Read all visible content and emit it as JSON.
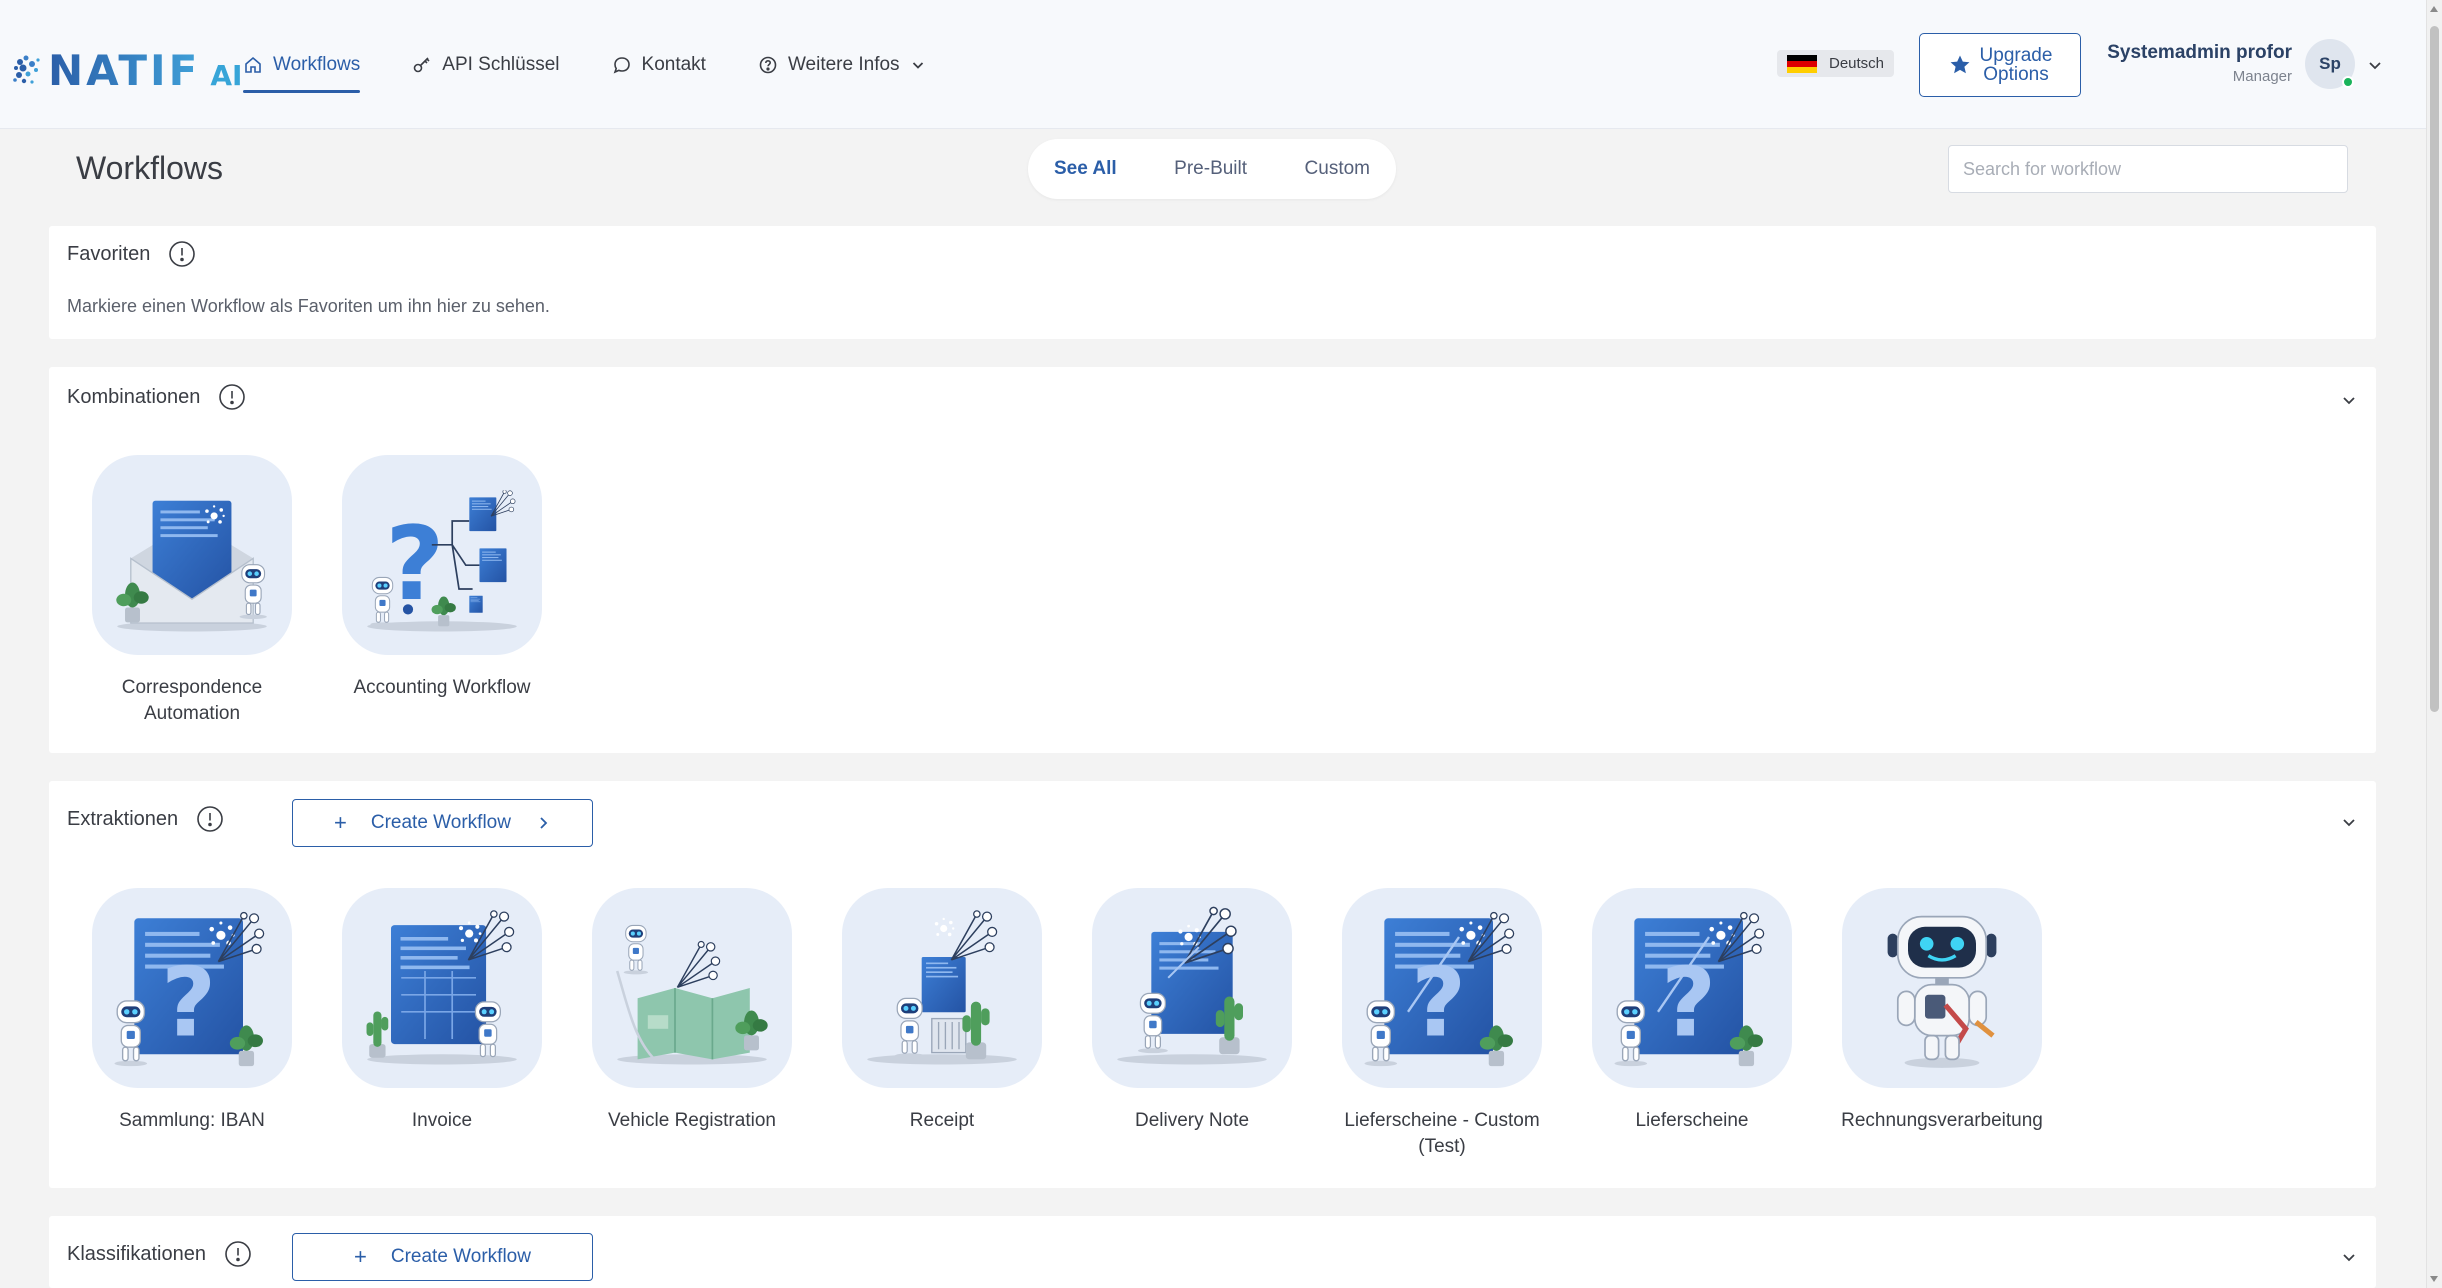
{
  "header": {
    "logo_text": "NATIF",
    "logo_ai": "AI",
    "nav": [
      {
        "label": "Workflows",
        "icon": "home-icon",
        "active": true
      },
      {
        "label": "API Schlüssel",
        "icon": "key-icon"
      },
      {
        "label": "Kontakt",
        "icon": "chat-icon"
      },
      {
        "label": "Weitere Infos",
        "icon": "help-circle-icon"
      }
    ],
    "language": "Deutsch",
    "upgrade_line1": "Upgrade",
    "upgrade_line2": "Options",
    "user_name": "Systemadmin profor",
    "user_role": "Manager",
    "avatar_initials": "Sp"
  },
  "page": {
    "title": "Workflows",
    "filters": [
      "See All",
      "Pre-Built",
      "Custom"
    ],
    "active_filter": "See All",
    "search_placeholder": "Search for workflow"
  },
  "sections": {
    "favoriten": {
      "title": "Favoriten",
      "description": "Markiere einen Workflow als Favoriten um ihn hier zu sehen."
    },
    "kombinationen": {
      "title": "Kombinationen",
      "items": [
        "Correspondence Automation",
        "Accounting Workflow"
      ]
    },
    "extraktionen": {
      "title": "Extraktionen",
      "create_label": "Create Workflow",
      "items": [
        "Sammlung: IBAN",
        "Invoice",
        "Vehicle Registration",
        "Receipt",
        "Delivery Note",
        "Lieferscheine - Custom (Test)",
        "Lieferscheine",
        "Rechnungsverarbeitung"
      ]
    },
    "klassifikationen": {
      "title": "Klassifikationen",
      "create_label": "Create Workflow"
    }
  },
  "colors": {
    "accent": "#2b5ea8",
    "card_bg": "#e6edf8",
    "online": "#1ab35a"
  }
}
